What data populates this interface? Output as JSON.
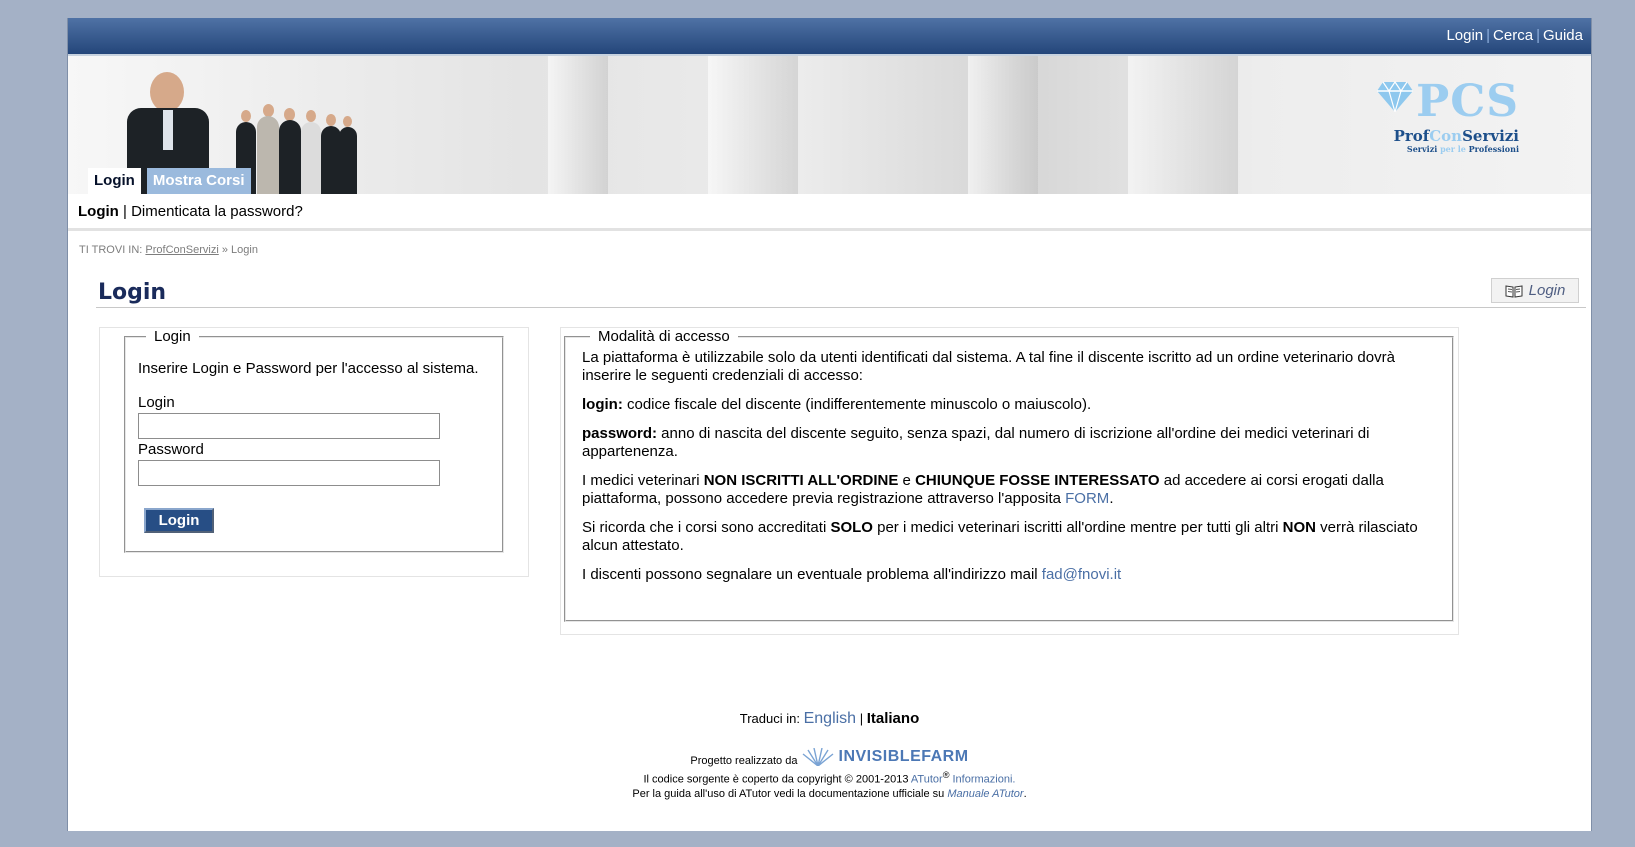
{
  "topbar": {
    "links": [
      "Login",
      "Cerca",
      "Guida"
    ]
  },
  "logo": {
    "mark": "PCS",
    "name_a": "Prof",
    "name_b": "Con",
    "name_c": "Servizi",
    "tagline_a": "Servizi ",
    "tagline_b": "per le",
    "tagline_c": " Professioni"
  },
  "tabs": [
    {
      "label": "Login",
      "active": true
    },
    {
      "label": "Mostra Corsi",
      "active": false
    }
  ],
  "subnav": {
    "current": "Login",
    "separator": "|",
    "link": "Dimenticata la password?"
  },
  "breadcrumb": {
    "prefix": "TI TROVI IN:",
    "home": "ProfConServizi",
    "sep": "»",
    "current": "Login"
  },
  "page_title": "Login",
  "help_button": {
    "label": "Login",
    "icon": "open-book-icon"
  },
  "login_form": {
    "legend": "Login",
    "intro": "Inserire Login e Password per l'accesso al sistema.",
    "login_label": "Login",
    "login_value": "",
    "password_label": "Password",
    "password_value": "",
    "submit_label": "Login"
  },
  "access_info": {
    "legend": "Modalità di accesso",
    "p1": "La piattaforma è utilizzabile solo da utenti identificati dal sistema. A tal fine il discente iscritto ad un ordine veterinario dovrà inserire le seguenti credenziali di accesso:",
    "p2_bold": "login:",
    "p2_text": " codice fiscale del discente (indifferentemente minuscolo o maiuscolo).",
    "p3_bold": "password:",
    "p3_text": " anno di nascita del discente seguito, senza spazi, dal numero di iscrizione all'ordine dei medici veterinari di appartenenza.",
    "p4_a": "I medici veterinari ",
    "p4_b": "NON ISCRITTI ALL'ORDINE",
    "p4_c": " e ",
    "p4_d": "CHIUNQUE FOSSE INTERESSATO",
    "p4_e": " ad accedere ai corsi erogati dalla piattaforma, possono accedere previa registrazione attraverso l'apposita ",
    "p4_link": "FORM",
    "p4_end": ".",
    "p5_a": "Si ricorda che i corsi sono accreditati ",
    "p5_b": "SOLO",
    "p5_c": " per i medici veterinari iscritti all'ordine mentre per tutti gli altri ",
    "p5_d": "NON",
    "p5_e": " verrà rilasciato alcun attestato.",
    "p6_text": "I discenti possono segnalare un eventuale problema all'indirizzo mail ",
    "p6_link": "fad@fnovi.it"
  },
  "footer": {
    "translate_label": "Traduci in:",
    "lang_en": "English",
    "lang_sep": "|",
    "lang_it": "Italiano",
    "project_label": "Progetto realizzato da",
    "company": "INVISIBLEFARM",
    "copyright_a": "Il codice sorgente è coperto da copyright © 2001-2013 ",
    "atutor": "ATutor",
    "registered": "®",
    "info_link": "Informazioni.",
    "guide_a": "Per la guida all'uso di ATutor vedi la documentazione ufficiale su ",
    "manual_link": "Manuale ATutor",
    "guide_end": "."
  },
  "colors": {
    "background": "#a4b1c6",
    "topbar": "#24467a",
    "title": "#1a2b5b",
    "link": "#4a6fa5",
    "button": "#274e85"
  }
}
